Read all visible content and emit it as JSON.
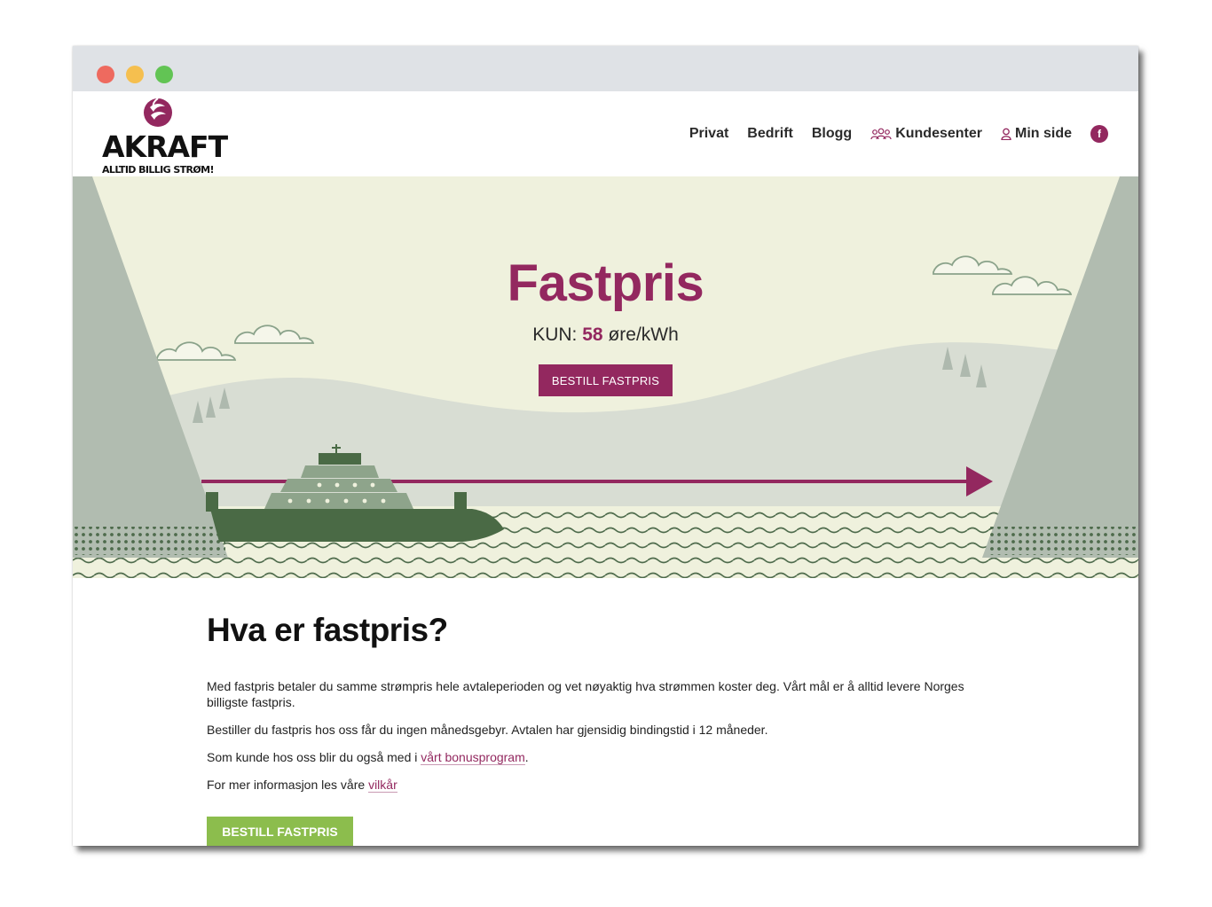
{
  "brand": {
    "name": "AKRAFT",
    "tagline": "ALLTID BILLIG STRØM!",
    "accent": "#93285f",
    "green": "#8cbd4d"
  },
  "nav": {
    "items": [
      {
        "label": "Privat",
        "icon": null
      },
      {
        "label": "Bedrift",
        "icon": null
      },
      {
        "label": "Blogg",
        "icon": null
      },
      {
        "label": "Kundesenter",
        "icon": "people-icon"
      },
      {
        "label": "Min side",
        "icon": "user-icon"
      }
    ],
    "facebook": "f"
  },
  "hero": {
    "title": "Fastpris",
    "price_prefix": "KUN:",
    "price_value": "58",
    "price_unit": "øre/kWh",
    "button": "BESTILL FASTPRIS"
  },
  "content": {
    "heading": "Hva er fastpris?",
    "p1": "Med fastpris betaler du samme strømpris hele avtaleperioden og vet nøyaktig hva strømmen koster deg. Vårt mål er å alltid levere Norges billigste fastpris.",
    "p2": "Bestiller du fastpris hos oss får du ingen månedsgebyr. Avtalen har gjensidig bindingstid i 12 måneder.",
    "p3_prefix": "Som kunde hos oss blir du også med i ",
    "p3_link": "vårt bonusprogram",
    "p3_suffix": ".",
    "p4_prefix": "For mer informasjon les våre ",
    "p4_link": "vilkår",
    "button": "BESTILL FASTPRIS"
  }
}
